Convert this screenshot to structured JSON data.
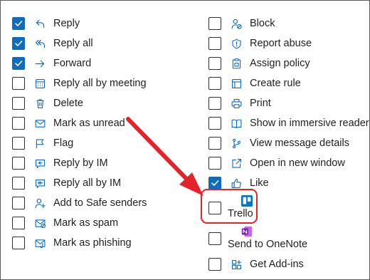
{
  "left_column": [
    {
      "label": "Reply",
      "checked": true,
      "icon": "reply-icon"
    },
    {
      "label": "Reply all",
      "checked": true,
      "icon": "reply-all-icon"
    },
    {
      "label": "Forward",
      "checked": true,
      "icon": "forward-icon"
    },
    {
      "label": "Reply all by meeting",
      "checked": false,
      "icon": "calendar-icon"
    },
    {
      "label": "Delete",
      "checked": false,
      "icon": "trash-icon"
    },
    {
      "label": "Mark as unread",
      "checked": false,
      "icon": "mail-unread-icon"
    },
    {
      "label": "Flag",
      "checked": false,
      "icon": "flag-icon"
    },
    {
      "label": "Reply by IM",
      "checked": false,
      "icon": "chat-reply-icon"
    },
    {
      "label": "Reply all by IM",
      "checked": false,
      "icon": "chat-reply-all-icon"
    },
    {
      "label": "Add to Safe senders",
      "checked": false,
      "icon": "person-add-icon"
    },
    {
      "label": "Mark as spam",
      "checked": false,
      "icon": "mail-spam-icon"
    },
    {
      "label": "Mark as phishing",
      "checked": false,
      "icon": "mail-phishing-icon"
    }
  ],
  "right_column": [
    {
      "label": "Block",
      "checked": false,
      "icon": "block-person-icon"
    },
    {
      "label": "Report abuse",
      "checked": false,
      "icon": "shield-icon"
    },
    {
      "label": "Assign policy",
      "checked": false,
      "icon": "clipboard-icon"
    },
    {
      "label": "Create rule",
      "checked": false,
      "icon": "rule-icon"
    },
    {
      "label": "Print",
      "checked": false,
      "icon": "printer-icon"
    },
    {
      "label": "Show in immersive reader",
      "checked": false,
      "icon": "immersive-reader-icon"
    },
    {
      "label": "View message details",
      "checked": false,
      "icon": "details-icon"
    },
    {
      "label": "Open in new window",
      "checked": false,
      "icon": "open-window-icon"
    },
    {
      "label": "Like",
      "checked": true,
      "icon": "thumbs-up-icon"
    },
    {
      "label": "Trello",
      "checked": false,
      "icon": "trello-icon"
    },
    {
      "label": "Send to OneNote",
      "checked": false,
      "icon": "onenote-icon"
    },
    {
      "label": "Get Add-ins",
      "checked": false,
      "icon": "add-ins-icon"
    }
  ],
  "colors": {
    "accent": "#0f6cbd",
    "callout": "#e3242b",
    "trello": "#0079bf",
    "onenote": "#7719aa"
  }
}
